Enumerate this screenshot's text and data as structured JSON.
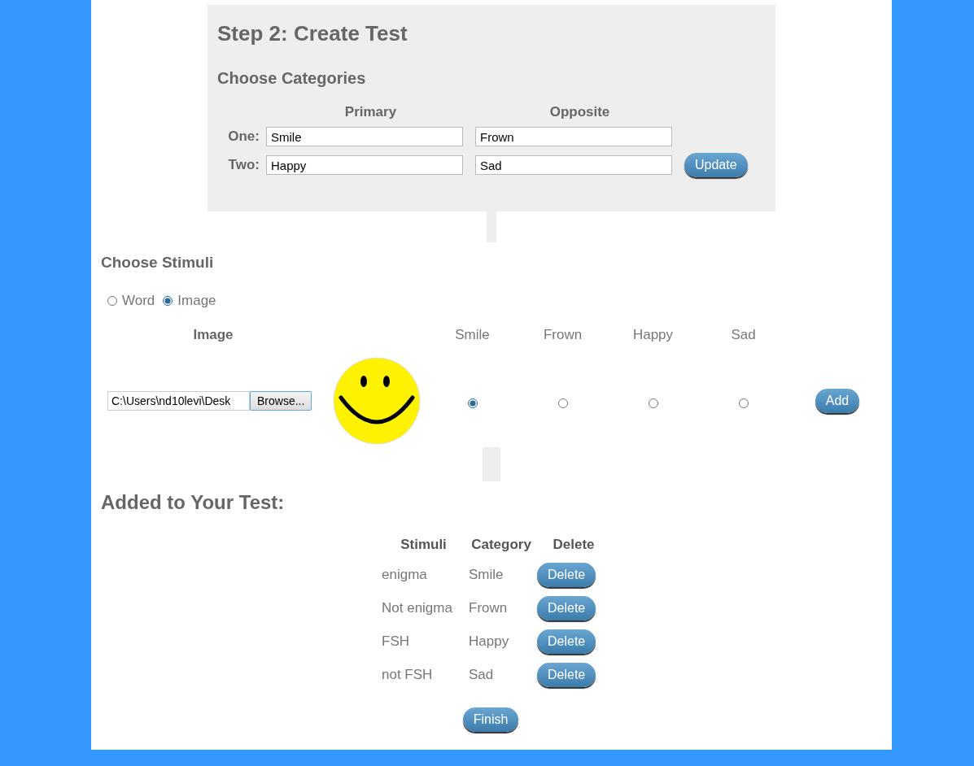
{
  "step": {
    "title": "Step 2: Create Test",
    "subtitle": "Choose Categories",
    "columns": [
      "Primary",
      "Opposite"
    ],
    "rows": [
      {
        "label": "One:",
        "primary": "Smile",
        "opposite": "Frown"
      },
      {
        "label": "Two:",
        "primary": "Happy",
        "opposite": "Sad"
      }
    ],
    "update_button": "Update"
  },
  "stimuli": {
    "title": "Choose Stimuli",
    "types": [
      {
        "label": "Word",
        "selected": false
      },
      {
        "label": "Image",
        "selected": true
      }
    ],
    "image_header": "Image",
    "file_path": "C:\\Users\\nd10levi\\Desk",
    "browse_button": "Browse...",
    "categories": [
      {
        "label": "Smile",
        "selected": true
      },
      {
        "label": "Frown",
        "selected": false
      },
      {
        "label": "Happy",
        "selected": false
      },
      {
        "label": "Sad",
        "selected": false
      }
    ],
    "add_button": "Add"
  },
  "added": {
    "title": "Added to Your Test:",
    "columns": [
      "Stimuli",
      "Category",
      "Delete"
    ],
    "rows": [
      {
        "stimulus": "enigma",
        "category": "Smile",
        "button": "Delete"
      },
      {
        "stimulus": "Not enigma",
        "category": "Frown",
        "button": "Delete"
      },
      {
        "stimulus": "FSH",
        "category": "Happy",
        "button": "Delete"
      },
      {
        "stimulus": "not FSH",
        "category": "Sad",
        "button": "Delete"
      }
    ],
    "finish_button": "Finish"
  }
}
